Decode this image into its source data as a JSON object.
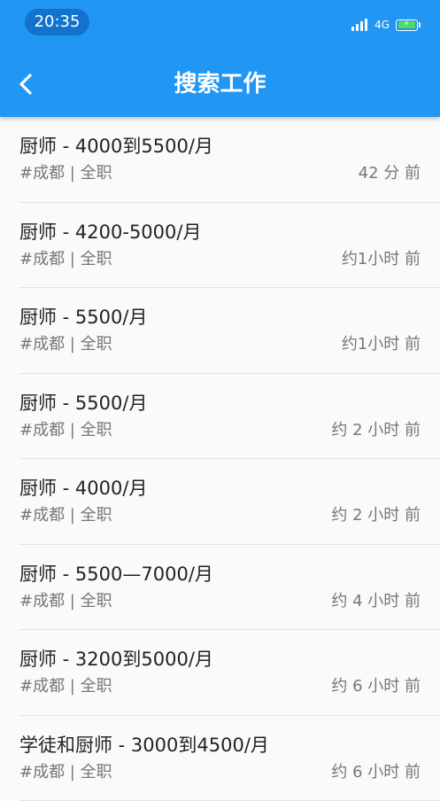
{
  "status_bar": {
    "time": "20:35",
    "network": "4G"
  },
  "header": {
    "title": "搜索工作",
    "back_icon": "chevron-left-icon"
  },
  "colors": {
    "primary": "#2196f3",
    "time_pill": "#1272cc",
    "battery_fill": "#4cd964",
    "background": "#fafafa"
  },
  "jobs": [
    {
      "title": "厨师 - 4000到5500/月",
      "meta": "#成都 | 全职",
      "time": "42 分 前"
    },
    {
      "title": "厨师 - 4200-5000/月",
      "meta": "#成都 | 全职",
      "time": "约1小时 前"
    },
    {
      "title": "厨师 - 5500/月",
      "meta": "#成都 | 全职",
      "time": "约1小时 前"
    },
    {
      "title": "厨师 - 5500/月",
      "meta": "#成都 | 全职",
      "time": "约 2 小时 前"
    },
    {
      "title": "厨师 - 4000/月",
      "meta": "#成都 | 全职",
      "time": "约 2 小时 前"
    },
    {
      "title": "厨师 - 5500—7000/月",
      "meta": "#成都 | 全职",
      "time": "约 4 小时 前"
    },
    {
      "title": "厨师 - 3200到5000/月",
      "meta": "#成都 | 全职",
      "time": "约 6 小时 前"
    },
    {
      "title": "学徒和厨师 - 3000到4500/月",
      "meta": "#成都 | 全职",
      "time": "约 6 小时 前"
    }
  ]
}
